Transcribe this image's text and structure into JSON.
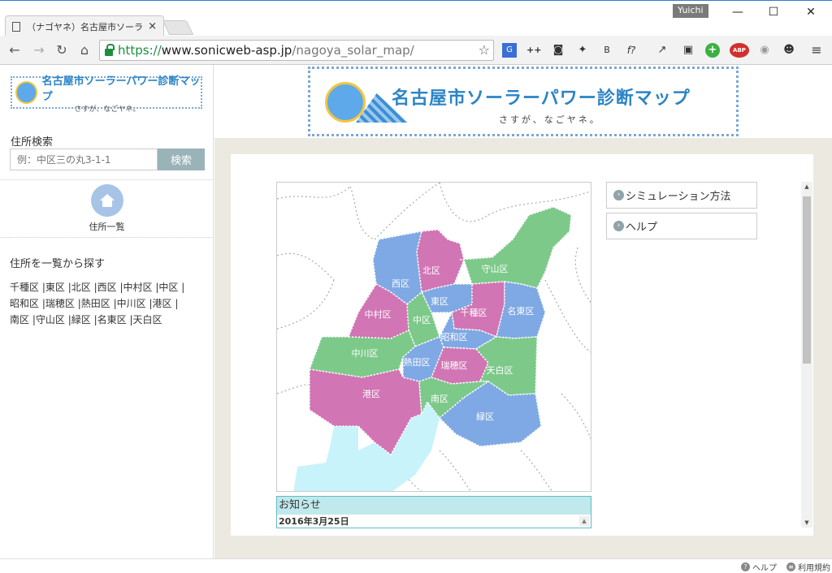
{
  "browser": {
    "tab_title": "（ナゴヤネ）名古屋市ソーラ·",
    "tab_close": "×",
    "user": "Yuichi",
    "minimize": "—",
    "maximize": "☐",
    "close": "✕",
    "url_scheme": "https://",
    "url_host": "www.sonicweb-asp.jp",
    "url_path": "/nagoya_solar_map/",
    "back": "←",
    "forward": "→",
    "reload": "↻",
    "home": "⌂",
    "bookmark_star": "☆",
    "extensions": [
      "G",
      "++",
      "◙",
      "✦",
      "B",
      "f?",
      "↗",
      "▣",
      "+",
      "ABP",
      "◉",
      "☻",
      "≡"
    ]
  },
  "sidebar": {
    "logo_title": "名古屋市ソーラーパワー診断マップ",
    "logo_sub": "さすが、なごヤネ。",
    "search_label": "住所検索",
    "search_placeholder": "例：中区三の丸3-1-1",
    "search_button": "検索",
    "address_list_label": "住所一覧",
    "list_title": "住所を一覧から探す",
    "wards": [
      "千種区",
      "東区",
      "北区",
      "西区",
      "中村区",
      "中区",
      "昭和区",
      "瑞穂区",
      "熱田区",
      "中川区",
      "港区",
      "南区",
      "守山区",
      "緑区",
      "名東区",
      "天白区"
    ],
    "separator": " |"
  },
  "banner": {
    "title": "名古屋市ソーラーパワー診断マップ",
    "subtitle": "さすが、なごヤネ。"
  },
  "map": {
    "labels": {
      "kita": "北区",
      "nishi": "西区",
      "moriyama": "守山区",
      "higashi": "東区",
      "nakamura": "中村区",
      "naka": "中区",
      "chikusa": "千種区",
      "meito": "名東区",
      "showa": "昭和区",
      "nakagawa": "中川区",
      "atsuta": "熱田区",
      "mizuho": "瑞穂区",
      "tempaku": "天白区",
      "minato": "港区",
      "minami": "南区",
      "midori": "緑区"
    },
    "colors": {
      "pink": "#d175b4",
      "blue": "#7fa9e4",
      "green": "#7dc98a",
      "water": "#c9f3fb"
    }
  },
  "links": {
    "simulation": "シミュレーション方法",
    "help": "ヘルプ"
  },
  "news": {
    "heading": "お知らせ",
    "date": "2016年3月25日"
  },
  "status": {
    "help": "ヘルプ",
    "terms": "利用規約"
  }
}
